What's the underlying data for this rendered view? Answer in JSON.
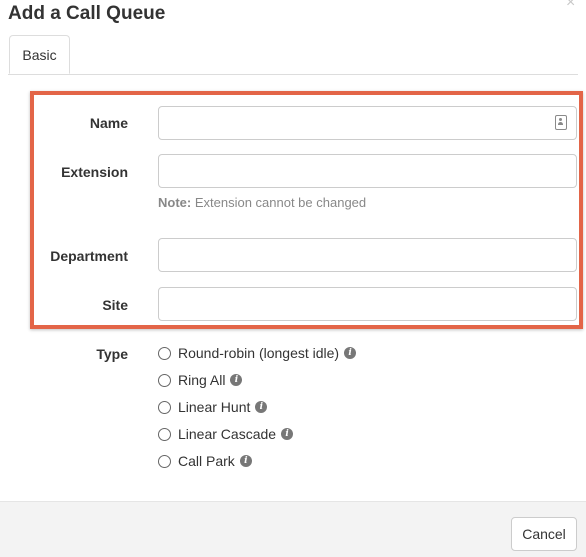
{
  "dialog": {
    "title": "Add a Call Queue",
    "close_glyph": "×"
  },
  "tabs": [
    {
      "label": "Basic",
      "active": true
    }
  ],
  "form": {
    "name": {
      "label": "Name",
      "value": "",
      "placeholder": ""
    },
    "extension": {
      "label": "Extension",
      "value": "",
      "placeholder": "",
      "note_prefix": "Note:",
      "note_text": " Extension cannot be changed"
    },
    "department": {
      "label": "Department",
      "value": "",
      "placeholder": ""
    },
    "site": {
      "label": "Site",
      "value": "",
      "placeholder": ""
    },
    "type": {
      "label": "Type",
      "options": [
        {
          "label": "Round-robin (longest idle)",
          "selected": false,
          "info_icon": "info-icon"
        },
        {
          "label": "Ring All",
          "selected": false,
          "info_icon": "info-icon"
        },
        {
          "label": "Linear Hunt",
          "selected": false,
          "info_icon": "info-icon"
        },
        {
          "label": "Linear Cascade",
          "selected": false,
          "info_icon": "info-icon"
        },
        {
          "label": "Call Park",
          "selected": false,
          "info_icon": "info-icon"
        }
      ]
    }
  },
  "footer": {
    "cancel_label": "Cancel"
  },
  "colors": {
    "highlight_border": "#e36548",
    "footer_bg": "#f3f3f3",
    "input_border": "#cccccc",
    "note_text": "#888888"
  }
}
